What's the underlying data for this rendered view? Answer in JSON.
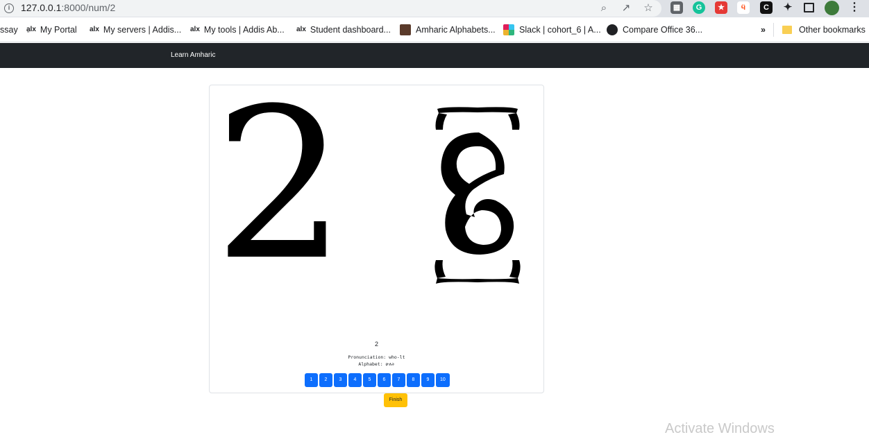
{
  "browser": {
    "url_host": "127.0.0.1",
    "url_rest": ":8000/num/2"
  },
  "bookmarks": [
    {
      "label": "ssay",
      "icon": "none"
    },
    {
      "label": "My Portal",
      "icon": "alx-icon"
    },
    {
      "label": "My servers | Addis...",
      "icon": "alx-icon"
    },
    {
      "label": "My tools | Addis Ab...",
      "icon": "alx-icon"
    },
    {
      "label": "Student dashboard...",
      "icon": "alx-icon"
    },
    {
      "label": "Amharic Alphabets...",
      "icon": "site-icon"
    },
    {
      "label": "Slack | cohort_6 | A...",
      "icon": "slack-icon"
    },
    {
      "label": "Compare Office 36...",
      "icon": "globe-icon"
    }
  ],
  "bookmarks_more": "»",
  "other_bookmarks": "Other bookmarks",
  "navbar": {
    "brand": "Learn Amharic"
  },
  "card": {
    "numeral": "2",
    "geez_numeral": "፪",
    "title": "2",
    "pronunciation": "Pronunciation: who-lt",
    "alphabet": "Alphabet: ሁለት"
  },
  "pagination": [
    "1",
    "2",
    "3",
    "4",
    "5",
    "6",
    "7",
    "8",
    "9",
    "10"
  ],
  "finish_label": "Finish",
  "watermark": "Activate Windows",
  "colors": {
    "navbar": "#212529",
    "page_button": "#0d6efd",
    "finish_button": "#ffc107"
  }
}
